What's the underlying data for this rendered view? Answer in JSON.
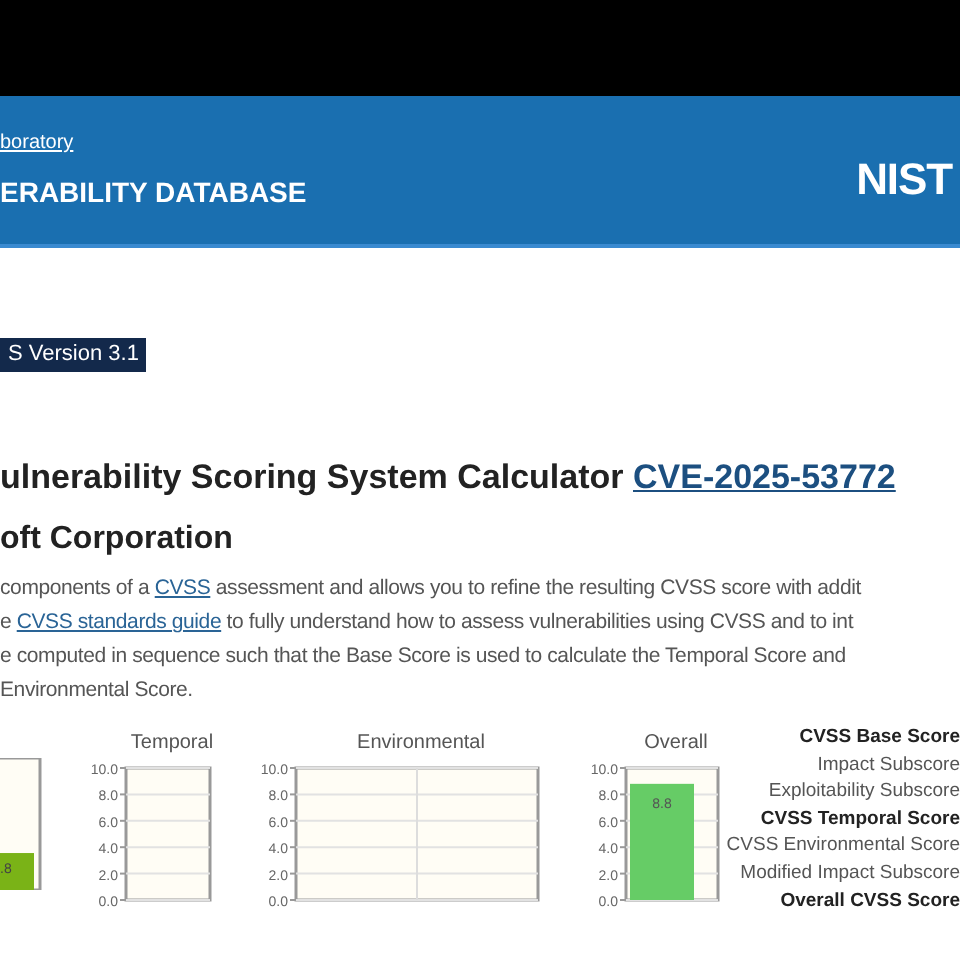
{
  "header": {
    "org_link": "boratory",
    "site_title": "ERABILITY DATABASE",
    "logo": "NIST"
  },
  "version_tab": {
    "label": "S Version 3.1",
    "selected": true
  },
  "title": {
    "text": "ulnerability Scoring System Calculator",
    "cve_link": "CVE-2025-53772"
  },
  "vendor": "oft Corporation",
  "intro_lines": [
    {
      "before": "components of a ",
      "link": "CVSS",
      "after": " assessment and allows you to refine the resulting CVSS score with addit"
    },
    {
      "before": "e ",
      "link": "CVSS standards guide",
      "after": " to fully understand how to assess vulnerabilities using CVSS and to int"
    },
    {
      "before": "e computed in sequence such that the Base Score is used to calculate the Temporal Score and"
    },
    {
      "before": " Environmental Score."
    }
  ],
  "base_chart_fragment": {
    "bar_label": ".8",
    "level": 0.28
  },
  "charts": [
    {
      "chart_data": {
        "type": "bar",
        "title": "Temporal",
        "grid": true,
        "ylim": [
          0,
          10
        ],
        "categories": [
          null
        ],
        "values": [
          null
        ],
        "yticks": [
          {
            "value": 10,
            "label": "10.0"
          },
          {
            "value": 8,
            "label": "8.0"
          },
          {
            "value": 6,
            "label": "6.0"
          },
          {
            "value": 4,
            "label": "4.0"
          },
          {
            "value": 2,
            "label": "2.0"
          },
          {
            "value": 0,
            "label": "0.0"
          }
        ]
      }
    },
    {
      "chart_data": {
        "type": "bar",
        "title": "Environmental",
        "grid": true,
        "ylim": [
          0,
          10
        ],
        "categories": [
          null
        ],
        "values": [
          null
        ],
        "yticks": [
          {
            "value": 10,
            "label": "10.0"
          },
          {
            "value": 8,
            "label": "8.0"
          },
          {
            "value": 6,
            "label": "6.0"
          },
          {
            "value": 4,
            "label": "4.0"
          },
          {
            "value": 2,
            "label": "2.0"
          },
          {
            "value": 0,
            "label": "0.0"
          }
        ]
      }
    },
    {
      "chart_data": {
        "type": "bar",
        "title": "Overall",
        "grid": true,
        "ylim": [
          0,
          10
        ],
        "categories": [
          null
        ],
        "values": [
          8.8
        ],
        "value_labels": [
          "8.8"
        ],
        "yticks": [
          {
            "value": 10,
            "label": "10.0"
          },
          {
            "value": 8,
            "label": "8.0"
          },
          {
            "value": 6,
            "label": "6.0"
          },
          {
            "value": 4,
            "label": "4.0"
          },
          {
            "value": 2,
            "label": "2.0"
          },
          {
            "value": 0,
            "label": "0.0"
          }
        ]
      }
    }
  ],
  "score_labels": [
    {
      "text": "CVSS Base Score",
      "emphasis": true
    },
    {
      "text": "Impact Subscore",
      "emphasis": false
    },
    {
      "text": "Exploitability Subscore",
      "emphasis": false
    },
    {
      "text": "CVSS Temporal Score",
      "emphasis": true
    },
    {
      "text": "CVSS Environmental Score",
      "emphasis": false
    },
    {
      "text": "Modified Impact Subscore",
      "emphasis": false
    },
    {
      "text": "Overall CVSS Score",
      "emphasis": true
    }
  ]
}
